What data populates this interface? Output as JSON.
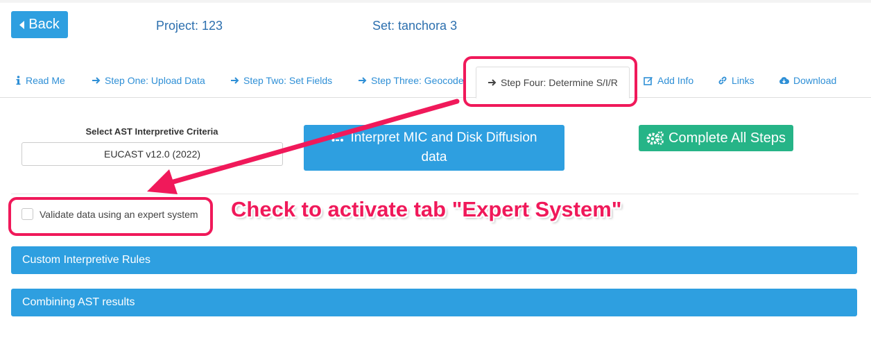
{
  "header": {
    "back_label": "Back",
    "project": "Project: 123",
    "set": "Set: tanchora 3"
  },
  "tabs": [
    {
      "label": "Read Me",
      "icon": "info-icon"
    },
    {
      "label": "Step One: Upload Data",
      "icon": "arrow-right-icon"
    },
    {
      "label": "Step Two: Set Fields",
      "icon": "arrow-right-icon"
    },
    {
      "label": "Step Three: Geocode",
      "icon": "arrow-right-icon"
    },
    {
      "label": "Step Four: Determine S/I/R",
      "icon": "arrow-right-icon",
      "active": true
    },
    {
      "label": "Add Info",
      "icon": "edit-icon"
    },
    {
      "label": "Links",
      "icon": "link-icon"
    },
    {
      "label": "Download",
      "icon": "cloud-download-icon"
    }
  ],
  "criteria": {
    "label": "Select AST Interpretive Criteria",
    "selected": "EUCAST v12.0 (2022)"
  },
  "interpret_button": {
    "line1": "Interpret MIC and Disk Diffusion",
    "line2": "data"
  },
  "complete_button": {
    "label": "Complete All Steps"
  },
  "validate": {
    "label": "Validate data using an expert system",
    "checked": false
  },
  "panels": [
    {
      "label": "Custom Interpretive Rules"
    },
    {
      "label": "Combining AST results"
    }
  ],
  "annotation": {
    "text": "Check to activate tab \"Expert System\""
  },
  "colors": {
    "primary": "#2e9fe0",
    "success": "#26b487",
    "tab_link": "#2e8fd6",
    "header_text": "#2c6fae",
    "highlight": "#f0195a"
  }
}
